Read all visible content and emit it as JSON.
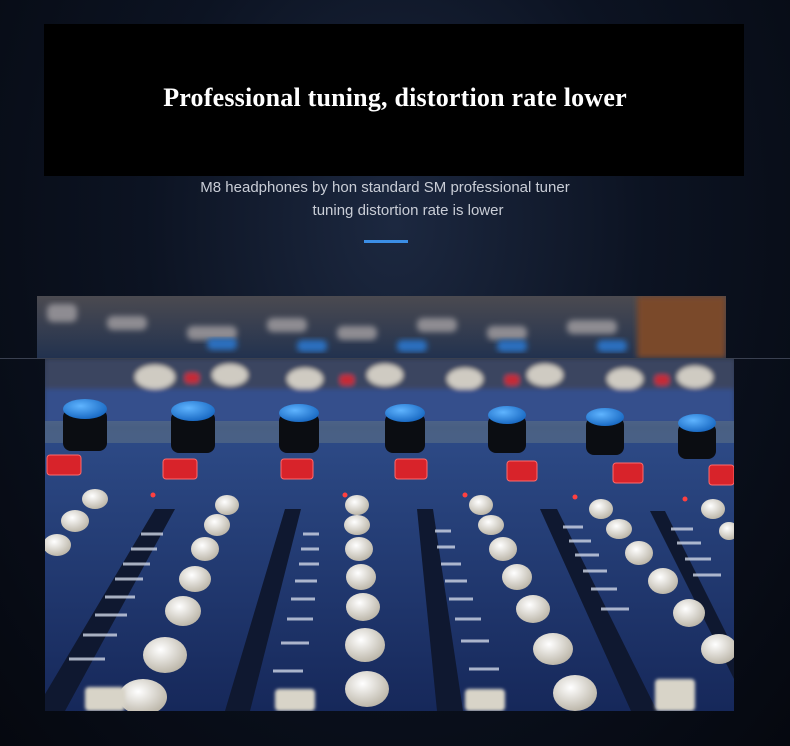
{
  "banner": {
    "headline": "Professional tuning, distortion rate lower",
    "subtitle_line1": "M8 headphones by hon standard SM professional tuner",
    "subtitle_line2": "tuning distortion rate is lower",
    "accent_color": "#3b8ee6"
  },
  "photo": {
    "subject": "mixing-console",
    "colors": {
      "panel": "#1f3a7a",
      "knob_cap": "#1e7fd6",
      "button_red": "#d8232a",
      "knob_white": "#e8e3d6"
    }
  }
}
